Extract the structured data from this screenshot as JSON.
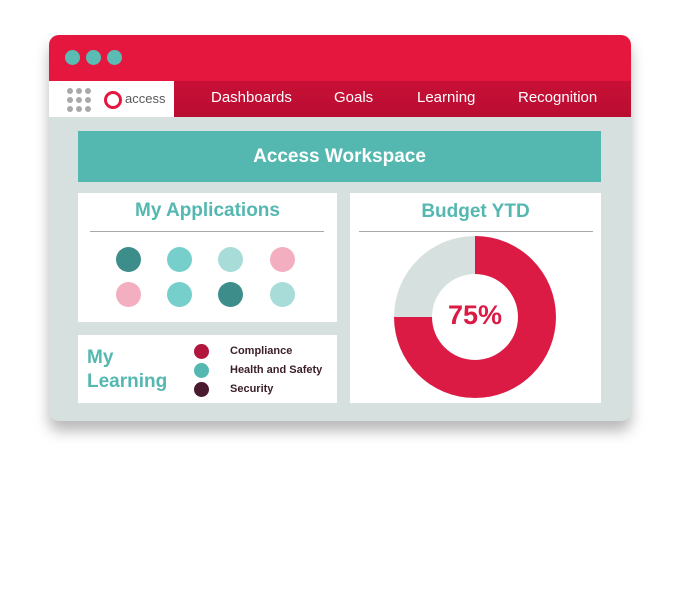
{
  "window": {
    "dot_color": "#5bbcb3",
    "titlebar_color": "#e6173f"
  },
  "navbar": {
    "logo_text": "access",
    "logo_grid_icon": "grid-dots-icon",
    "items": [
      {
        "label": "Dashboards"
      },
      {
        "label": "Goals"
      },
      {
        "label": "Learning"
      },
      {
        "label": "Recognition"
      }
    ]
  },
  "header": {
    "title": "Access Workspace",
    "color": "#54b8b0"
  },
  "applications": {
    "title": "My Applications",
    "icons": [
      {
        "color": "#3d8e8b"
      },
      {
        "color": "#76cfcb"
      },
      {
        "color": "#a8dcd8"
      },
      {
        "color": "#f3afc0"
      },
      {
        "color": "#f3afc0"
      },
      {
        "color": "#76cfcb"
      },
      {
        "color": "#3d8e8b"
      },
      {
        "color": "#a8dcd8"
      }
    ]
  },
  "learning": {
    "title_line1": "My",
    "title_line2": "Learning",
    "items": [
      {
        "label": "Compliance",
        "color": "#b3163d"
      },
      {
        "label": "Health and Safety",
        "color": "#54b8b0"
      },
      {
        "label": "Security",
        "color": "#4a1a2e"
      }
    ]
  },
  "budget": {
    "title": "Budget YTD",
    "percent_label": "75%"
  },
  "chart_data": {
    "type": "pie",
    "title": "Budget YTD",
    "values": [
      75,
      25
    ],
    "colors": [
      "#dc1b45",
      "#d5e0df"
    ],
    "center_label": "75%"
  }
}
